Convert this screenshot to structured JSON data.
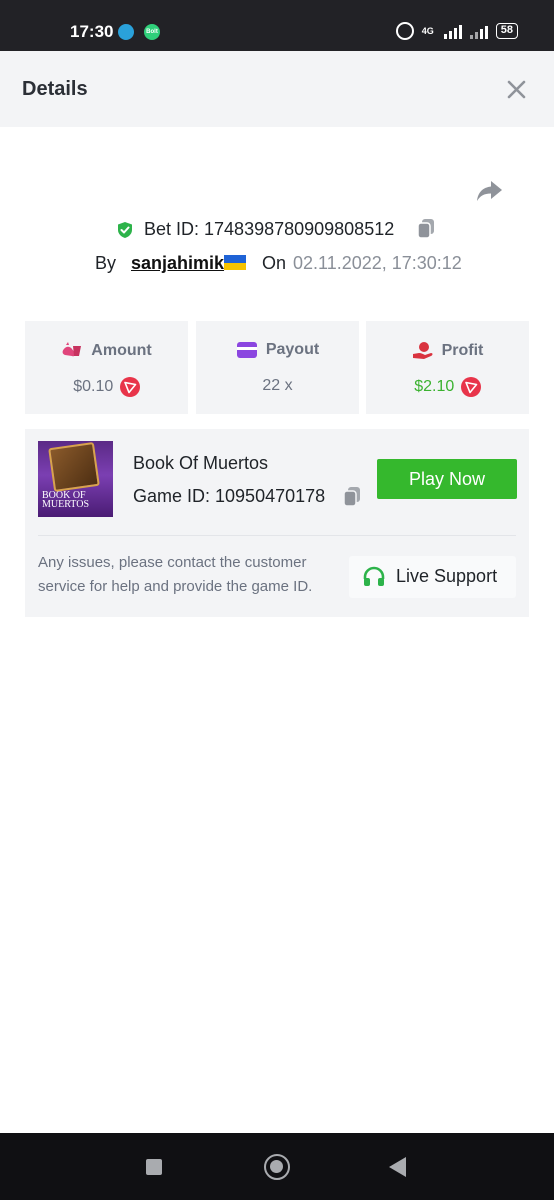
{
  "status_bar": {
    "time": "17:30",
    "bolt_label": "Bolt",
    "network": "4G",
    "battery": "58",
    "icons": [
      "telegram-icon",
      "bolt-icon",
      "alarm-icon",
      "signal-icon",
      "battery-icon"
    ]
  },
  "header": {
    "title": "Details",
    "close_icon": "close-icon"
  },
  "bet": {
    "label": "Bet ID: 1748398780909808512",
    "by_label": "By",
    "username": "sanjahimik",
    "on_label": "On",
    "datetime": "02.11.2022, 17:30:12",
    "colors": {
      "verified": "#2db34a",
      "date_text": "#8a8f98"
    }
  },
  "stats": {
    "amount": {
      "label": "Amount",
      "value": "$0.10",
      "icon": "money-bag-icon"
    },
    "payout": {
      "label": "Payout",
      "value": "22 x",
      "icon": "card-icon"
    },
    "profit": {
      "label": "Profit",
      "value": "$2.10",
      "icon": "hand-coin-icon",
      "value_color": "#3bb230"
    },
    "coin_icon": "tron-coin-icon"
  },
  "game": {
    "thumb_title": "Book of Muertos",
    "name": "Book Of Muertos",
    "id_label": "Game ID: 10950470178",
    "play_label": "Play Now",
    "play_color": "#35b82d",
    "issues_text": "Any issues, please contact the customer service for help and provide the game ID.",
    "support_label": "Live Support",
    "support_color": "#2db34a"
  },
  "nav": {
    "icons": [
      "recents-icon",
      "home-icon",
      "back-icon"
    ]
  }
}
